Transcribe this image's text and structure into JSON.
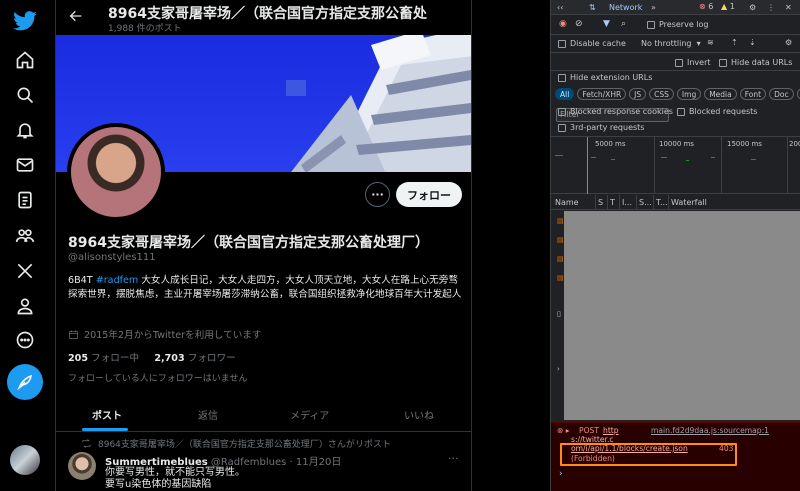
{
  "nav": {
    "icons": [
      "twitter-bird-icon",
      "home-icon",
      "search-icon",
      "bell-icon",
      "mail-icon",
      "list-icon",
      "communities-icon",
      "x-icon",
      "profile-icon",
      "more-icon"
    ]
  },
  "profile_header": {
    "title": "8964支家哥屠宰场／（联合国官方指定支那公畜处",
    "post_count": "1,988 件のポスト"
  },
  "profile": {
    "more_label": "···",
    "follow_label": "フォロー",
    "name": "8964支家哥屠宰场／（联合国官方指定支那公畜处理厂）",
    "handle": "@alisonstyles111",
    "bio_prefix": "6B4T ",
    "bio_tag": "#radfem",
    "bio_rest": " 大女人成长日记，大女人走四方，大女人顶天立地，大女人在路上心无旁骛探索世界，摆脱焦虑，主业开屠宰场屠莎滞纳公畜，联合国组织拯救净化地球百年大计发起人",
    "joined": "2015年2月からTwitterを利用しています",
    "following_count": "205",
    "following_label": " フォロー中",
    "followers_count": "2,703",
    "followers_label": " フォロワー",
    "not_followed": "フォローしている人にフォロワーはいません"
  },
  "tabs": [
    "ポスト",
    "返信",
    "メディア",
    "いいね"
  ],
  "tweet": {
    "repost_line": "8964支家哥屠宰场／（联合国官方指定支那公畜处理厂）さんがリポスト",
    "author": "Summertimeblues",
    "author_handle": " @Radfemblues · 11月20日",
    "more": "···",
    "line1": "你要写男性，就不能只写男性。",
    "line2": "要写u染色体的基因缺陷"
  },
  "devtools": {
    "tab_label": "Network",
    "error_count": "6",
    "warn_count": "1",
    "preserve_log": "Preserve log",
    "disable_cache": "Disable cache",
    "throttling": "No throttling",
    "filter_placeholder": "Filter",
    "invert": "Invert",
    "hide_data_urls": "Hide data URLs",
    "hide_extension_urls": "Hide extension URLs",
    "chips": [
      "All",
      "Fetch/XHR",
      "JS",
      "CSS",
      "Img",
      "Media",
      "Font",
      "Doc",
      "WS"
    ],
    "blocked_response_cookies": "Blocked response cookies",
    "blocked_requests": "Blocked requests",
    "third_party": "3rd-party requests",
    "ticks": [
      "5000 ms",
      "10000 ms",
      "15000 ms",
      "200"
    ],
    "columns": [
      "Name",
      "S",
      "T",
      "I...",
      "S...",
      "T...",
      "Waterfall"
    ],
    "console": {
      "method": "POST",
      "url1": "http",
      "url2": "s://twitter.c",
      "url3": "om/i/api/1.1/blocks/create.json",
      "status": "403",
      "status_text": "(Forbidden)",
      "source": "main.fd2d9daa.js:sourcemap:1",
      "prompt": "›"
    }
  },
  "colors": {
    "accent": "#1d9bf0",
    "background": "#000000",
    "devtools_bg": "#202124",
    "error": "#f28b82",
    "highlight": "#ff8c1a"
  }
}
